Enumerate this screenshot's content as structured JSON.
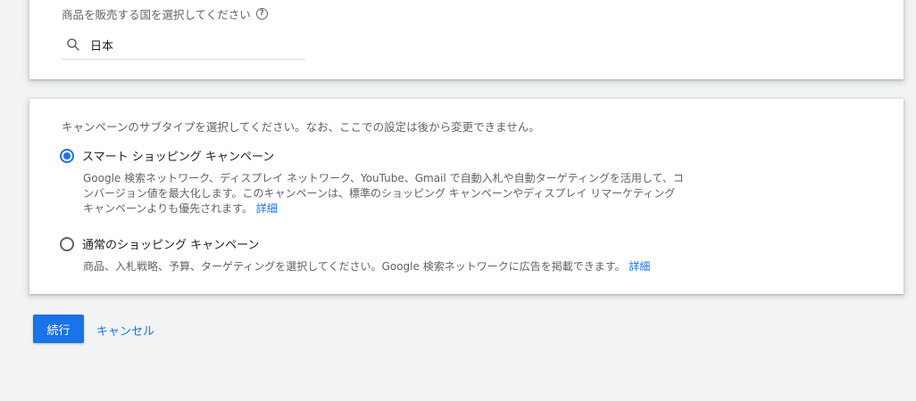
{
  "country_section": {
    "label": "商品を販売する国を選択してください",
    "help_icon": "help-circle-icon",
    "search": {
      "icon": "search-icon",
      "value": "日本"
    }
  },
  "subtype_section": {
    "description": "キャンペーンのサブタイプを選択してください。なお、ここでの設定は後から変更できません。",
    "options": [
      {
        "label": "スマート ショッピング キャンペーン",
        "selected": true,
        "description_lines": [
          "Google 検索ネットワーク、ディスプレイ ネットワーク、YouTube、Gmail で自動入札や自動ターゲティングを活用して、コ",
          "ンバージョン値を最大化します。このキャンペーンは、標準のショッピング キャンペーンやディスプレイ リマーケティング",
          "キャンペーンよりも優先されます。"
        ],
        "link": "詳細"
      },
      {
        "label": "通常のショッピング キャンペーン",
        "selected": false,
        "description": "商品、入札戦略、予算、ターゲティングを選択してください。Google 検索ネットワークに広告を掲載できます。",
        "link": "詳細"
      }
    ]
  },
  "actions": {
    "continue_label": "続行",
    "cancel_label": "キャンセル"
  },
  "colors": {
    "accent": "#1a73e8",
    "background": "#f1f3f4",
    "card": "#ffffff",
    "text_secondary": "#5f6368"
  }
}
